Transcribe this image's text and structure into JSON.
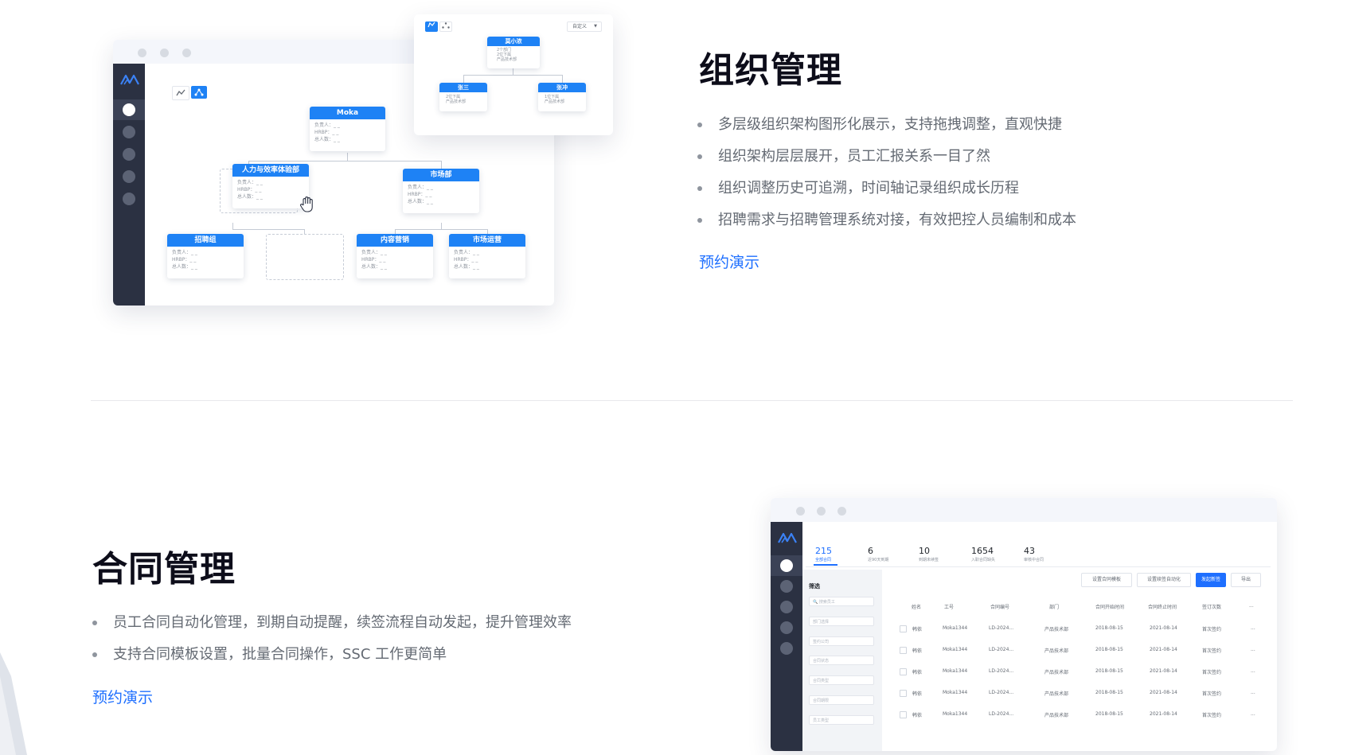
{
  "org": {
    "title": "组织管理",
    "bullets": [
      "多层级组织架构图形化展示，支持拖拽调整，直观快捷",
      "组织架构层层展开，员工汇报关系一目了然",
      "组织调整历史可追溯，时间轴记录组织成长历程",
      "招聘需求与招聘管理系统对接，有效把控人员编制和成本"
    ],
    "demo_link": "预约演示"
  },
  "contract": {
    "title": "合同管理",
    "bullets": [
      "员工合同自动化管理，到期自动提醒，续签流程自动发起，提升管理效率",
      "支持合同模板设置，批量合同操作，SSC 工作更简单"
    ],
    "demo_link": "预约演示"
  },
  "org_chart": {
    "field_labels": [
      "负责人：",
      "HRBP：",
      "总人数："
    ],
    "placeholder": "_ _",
    "root": "Moka",
    "level2": [
      "人力与效率体验部",
      "市场部"
    ],
    "level3": [
      "招聘组",
      "内容营销",
      "市场运营"
    ]
  },
  "org_popup": {
    "dropdown": "自定义",
    "root": "莫小浓",
    "root_lines": [
      "2个部门",
      "2位下属",
      "产品技术部"
    ],
    "children": [
      {
        "name": "张三",
        "lines": [
          "2位下属",
          "产品技术部"
        ]
      },
      {
        "name": "张冲",
        "lines": [
          "1位下属",
          "产品技术部"
        ]
      }
    ]
  },
  "contract_app": {
    "stats": [
      {
        "value": "215",
        "label": "全部合同"
      },
      {
        "value": "6",
        "label": "近90天到期"
      },
      {
        "value": "10",
        "label": "到期未续签"
      },
      {
        "value": "1654",
        "label": "入职合同缺失"
      },
      {
        "value": "43",
        "label": "审核中合同"
      }
    ],
    "filter_title": "筛选",
    "filters": [
      "搜索员工",
      "部门选择",
      "签约公司",
      "合同状态",
      "合同类型",
      "合同期限",
      "员工类型"
    ],
    "buttons": [
      "设置合同模板",
      "设置续签自动化",
      "发起新签",
      "导出"
    ],
    "columns": [
      "姓名",
      "工号",
      "合同编号",
      "部门",
      "合同开始时间",
      "合同终止时间",
      "签订次数",
      "..."
    ],
    "rows": [
      [
        "韩依",
        "Moka1344",
        "LD-2024...",
        "产品技术部",
        "2018-08-15",
        "2021-08-14",
        "首次签约",
        "..."
      ],
      [
        "韩依",
        "Moka1344",
        "LD-2024...",
        "产品技术部",
        "2018-08-15",
        "2021-08-14",
        "首次签约",
        "..."
      ],
      [
        "韩依",
        "Moka1344",
        "LD-2024...",
        "产品技术部",
        "2018-08-15",
        "2021-08-14",
        "首次签约",
        "..."
      ],
      [
        "韩依",
        "Moka1344",
        "LD-2024...",
        "产品技术部",
        "2018-08-15",
        "2021-08-14",
        "首次签约",
        "..."
      ],
      [
        "韩依",
        "Moka1344",
        "LD-2024...",
        "产品技术部",
        "2018-08-15",
        "2021-08-14",
        "首次签约",
        "..."
      ]
    ]
  },
  "colors": {
    "accent": "#1e6fff",
    "node_header": "#1e82f5",
    "sidebar": "#2b3142",
    "title": "#0d0d1a",
    "bullet_text": "#646a73"
  },
  "icons": [
    "moka-logo-icon",
    "line-chart-icon",
    "org-tree-icon",
    "hand-cursor-icon",
    "chevron-down-icon"
  ]
}
